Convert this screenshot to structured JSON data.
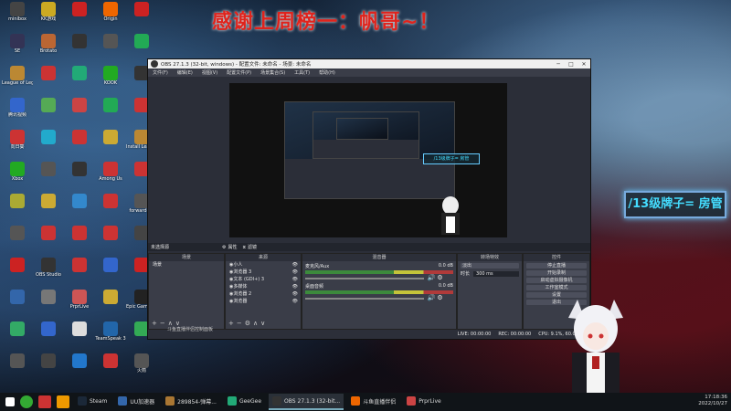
{
  "banner": "感谢上周榜一：帆哥~！",
  "room_tag": "/13级牌子= 房管",
  "desktop_icons": [
    {
      "label": "minibox",
      "color": "#444"
    },
    {
      "label": "SE",
      "color": "#335"
    },
    {
      "label": "League of Legends",
      "color": "#b83"
    },
    {
      "label": "腾讯视频",
      "color": "#36c"
    },
    {
      "label": "向日葵",
      "color": "#c33"
    },
    {
      "label": "Xbox",
      "color": "#2a2"
    },
    {
      "label": "",
      "color": "#aa3"
    },
    {
      "label": "",
      "color": "#555"
    },
    {
      "label": "",
      "color": "#c22"
    },
    {
      "label": "",
      "color": "#36a"
    },
    {
      "label": "",
      "color": "#3a6"
    },
    {
      "label": "",
      "color": "#555"
    },
    {
      "label": "KK游戏",
      "color": "#ca2"
    },
    {
      "label": "Brotato",
      "color": "#b63"
    },
    {
      "label": "",
      "color": "#c33"
    },
    {
      "label": "",
      "color": "#5a5"
    },
    {
      "label": "",
      "color": "#2ac"
    },
    {
      "label": "",
      "color": "#555"
    },
    {
      "label": "",
      "color": "#ca3"
    },
    {
      "label": "",
      "color": "#c33"
    },
    {
      "label": "OBS Studio",
      "color": "#333"
    },
    {
      "label": "",
      "color": "#777"
    },
    {
      "label": "",
      "color": "#36c"
    },
    {
      "label": "",
      "color": "#444"
    },
    {
      "label": "",
      "color": "#c22"
    },
    {
      "label": "",
      "color": "#333"
    },
    {
      "label": "",
      "color": "#2a7"
    },
    {
      "label": "",
      "color": "#c44"
    },
    {
      "label": "",
      "color": "#c33"
    },
    {
      "label": "",
      "color": "#333"
    },
    {
      "label": "",
      "color": "#38c"
    },
    {
      "label": "",
      "color": "#c33"
    },
    {
      "label": "",
      "color": "#c33"
    },
    {
      "label": "PrprLive",
      "color": "#c55"
    },
    {
      "label": "",
      "color": "#ddd"
    },
    {
      "label": "",
      "color": "#27c"
    },
    {
      "label": "Origin",
      "color": "#e60"
    },
    {
      "label": "",
      "color": "#555"
    },
    {
      "label": "KOOK",
      "color": "#2a2"
    },
    {
      "label": "",
      "color": "#2a5"
    },
    {
      "label": "",
      "color": "#ca3"
    },
    {
      "label": "Among Us",
      "color": "#c33"
    },
    {
      "label": "",
      "color": "#c33"
    },
    {
      "label": "",
      "color": "#c33"
    },
    {
      "label": "",
      "color": "#36c"
    },
    {
      "label": "",
      "color": "#ca3"
    },
    {
      "label": "TeamSpeak 3",
      "color": "#26a"
    },
    {
      "label": "",
      "color": "#c33"
    },
    {
      "label": "",
      "color": "#c22"
    },
    {
      "label": "",
      "color": "#2a5"
    },
    {
      "label": "",
      "color": "#333"
    },
    {
      "label": "",
      "color": "#c33"
    },
    {
      "label": "Install League",
      "color": "#b83"
    },
    {
      "label": "",
      "color": "#c33"
    },
    {
      "label": "forward-02",
      "color": "#555"
    },
    {
      "label": "",
      "color": "#444"
    },
    {
      "label": "",
      "color": "#c22"
    },
    {
      "label": "Epic Games Launcher",
      "color": "#222"
    },
    {
      "label": "",
      "color": "#3a5"
    },
    {
      "label": "火箭",
      "color": "#555"
    }
  ],
  "obs": {
    "title": "OBS 27.1.3 (32-bit, windows) - 配置文件: 未命名 - 场景: 未命名",
    "menus": [
      "文件(F)",
      "编辑(E)",
      "视图(V)",
      "配置文件(P)",
      "场景集合(S)",
      "工具(T)",
      "帮助(H)"
    ],
    "no_source_selected": "未选择源",
    "props_btn": "属性",
    "filters_btn": "滤镜",
    "panels": {
      "scenes": {
        "title": "场景",
        "items": [
          "场景"
        ]
      },
      "sources": {
        "title": "来源",
        "items": [
          "小人",
          "浏览器 3",
          "文本 (GDI+) 3",
          "多媒体",
          "浏览器 2",
          "浏览器"
        ]
      },
      "mixer": {
        "title": "混音器",
        "rows": [
          {
            "name": "麦克风/Aux",
            "db": "0.0 dB"
          },
          {
            "name": "桌面音频",
            "db": "0.0 dB"
          }
        ]
      },
      "transitions": {
        "title": "转场特效",
        "type": "淡出",
        "duration_label": "时长",
        "duration": "300 ms"
      },
      "controls": {
        "title": "控件",
        "buttons": [
          "停止直播",
          "开始录制",
          "启动虚拟摄像机",
          "工作室模式",
          "设置",
          "退出"
        ]
      }
    },
    "status": {
      "live": "LIVE: 00:00:00",
      "rec": "REC: 00:00:00",
      "cpu": "CPU: 9.1%, 60.00 fps"
    }
  },
  "toast": "斗鱼直播伴侣控制面板",
  "taskbar": {
    "apps": [
      "Steam",
      "UU加速器",
      "289854-弹幕...",
      "GeeGee",
      "OBS 27.1.3 (32-bit...",
      "斗鱼直播伴侣",
      "PrprLive"
    ],
    "time": "17:18:36",
    "date": "2022/10/27"
  }
}
